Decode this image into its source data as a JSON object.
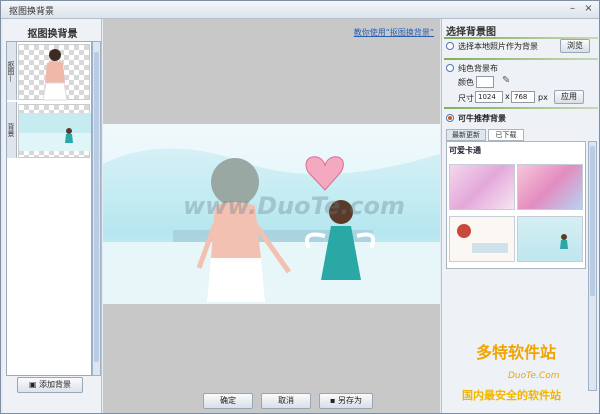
{
  "window": {
    "title": "抠图换背景",
    "min": "–",
    "close": "×"
  },
  "left_panel": {
    "heading": "抠图换背景",
    "tab1": "抠图—",
    "tab2": "背景",
    "add_bg_label": "添加背景"
  },
  "canvas": {
    "help_link": "教你使用“抠图换背景”",
    "watermark": "www.DuoTe.com"
  },
  "bottom_buttons": {
    "ok": "确定",
    "cancel": "取消",
    "save_as": "另存为"
  },
  "right_panel": {
    "heading": "选择背景图",
    "option_local": "选择本地照片作为背景",
    "browse": "浏览",
    "option_solid": "纯色背景布",
    "color_label": "颜色",
    "size_label": "尺寸",
    "width": "1024",
    "x": "x",
    "height": "768",
    "unit": "px",
    "apply": "应用",
    "option_recommend": "可牛推荐背景",
    "tab_latest": "最新更新",
    "tab_downloaded": "已下载",
    "category": "可爱卡通"
  },
  "site_watermark": {
    "logo": "多特软件站",
    "sub": "DuoTe.Com",
    "slogan": "国内最安全的软件站"
  },
  "colors": {
    "accent_green": "#7fb05a",
    "link_blue": "#2a5fb0",
    "radio_selected": "#c35a2b"
  }
}
